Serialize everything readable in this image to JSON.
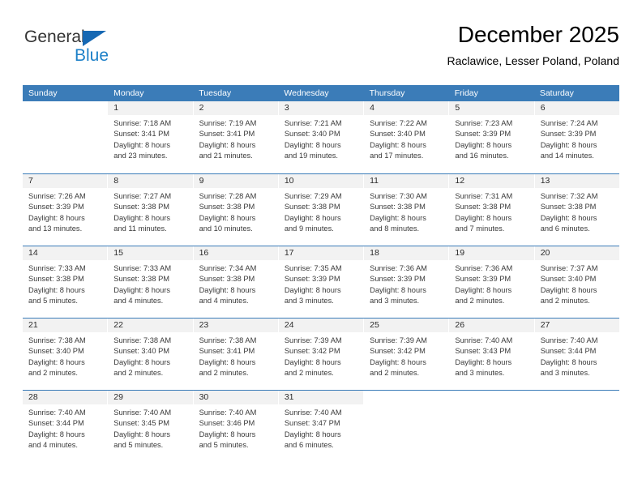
{
  "logo": {
    "name_part1": "General",
    "name_part2": "Blue",
    "triangle_color": "#1668b3",
    "blue_color": "#1d80c8"
  },
  "header": {
    "title": "December 2025",
    "subtitle": "Raclawice, Lesser Poland, Poland"
  },
  "theme": {
    "header_blue": "#3b7cb8",
    "daynum_bg": "#f2f2f2"
  },
  "weekdays": [
    "Sunday",
    "Monday",
    "Tuesday",
    "Wednesday",
    "Thursday",
    "Friday",
    "Saturday"
  ],
  "weeks": [
    [
      {
        "day": "",
        "lines": []
      },
      {
        "day": "1",
        "lines": [
          "Sunrise: 7:18 AM",
          "Sunset: 3:41 PM",
          "Daylight: 8 hours",
          "and 23 minutes."
        ]
      },
      {
        "day": "2",
        "lines": [
          "Sunrise: 7:19 AM",
          "Sunset: 3:41 PM",
          "Daylight: 8 hours",
          "and 21 minutes."
        ]
      },
      {
        "day": "3",
        "lines": [
          "Sunrise: 7:21 AM",
          "Sunset: 3:40 PM",
          "Daylight: 8 hours",
          "and 19 minutes."
        ]
      },
      {
        "day": "4",
        "lines": [
          "Sunrise: 7:22 AM",
          "Sunset: 3:40 PM",
          "Daylight: 8 hours",
          "and 17 minutes."
        ]
      },
      {
        "day": "5",
        "lines": [
          "Sunrise: 7:23 AM",
          "Sunset: 3:39 PM",
          "Daylight: 8 hours",
          "and 16 minutes."
        ]
      },
      {
        "day": "6",
        "lines": [
          "Sunrise: 7:24 AM",
          "Sunset: 3:39 PM",
          "Daylight: 8 hours",
          "and 14 minutes."
        ]
      }
    ],
    [
      {
        "day": "7",
        "lines": [
          "Sunrise: 7:26 AM",
          "Sunset: 3:39 PM",
          "Daylight: 8 hours",
          "and 13 minutes."
        ]
      },
      {
        "day": "8",
        "lines": [
          "Sunrise: 7:27 AM",
          "Sunset: 3:38 PM",
          "Daylight: 8 hours",
          "and 11 minutes."
        ]
      },
      {
        "day": "9",
        "lines": [
          "Sunrise: 7:28 AM",
          "Sunset: 3:38 PM",
          "Daylight: 8 hours",
          "and 10 minutes."
        ]
      },
      {
        "day": "10",
        "lines": [
          "Sunrise: 7:29 AM",
          "Sunset: 3:38 PM",
          "Daylight: 8 hours",
          "and 9 minutes."
        ]
      },
      {
        "day": "11",
        "lines": [
          "Sunrise: 7:30 AM",
          "Sunset: 3:38 PM",
          "Daylight: 8 hours",
          "and 8 minutes."
        ]
      },
      {
        "day": "12",
        "lines": [
          "Sunrise: 7:31 AM",
          "Sunset: 3:38 PM",
          "Daylight: 8 hours",
          "and 7 minutes."
        ]
      },
      {
        "day": "13",
        "lines": [
          "Sunrise: 7:32 AM",
          "Sunset: 3:38 PM",
          "Daylight: 8 hours",
          "and 6 minutes."
        ]
      }
    ],
    [
      {
        "day": "14",
        "lines": [
          "Sunrise: 7:33 AM",
          "Sunset: 3:38 PM",
          "Daylight: 8 hours",
          "and 5 minutes."
        ]
      },
      {
        "day": "15",
        "lines": [
          "Sunrise: 7:33 AM",
          "Sunset: 3:38 PM",
          "Daylight: 8 hours",
          "and 4 minutes."
        ]
      },
      {
        "day": "16",
        "lines": [
          "Sunrise: 7:34 AM",
          "Sunset: 3:38 PM",
          "Daylight: 8 hours",
          "and 4 minutes."
        ]
      },
      {
        "day": "17",
        "lines": [
          "Sunrise: 7:35 AM",
          "Sunset: 3:39 PM",
          "Daylight: 8 hours",
          "and 3 minutes."
        ]
      },
      {
        "day": "18",
        "lines": [
          "Sunrise: 7:36 AM",
          "Sunset: 3:39 PM",
          "Daylight: 8 hours",
          "and 3 minutes."
        ]
      },
      {
        "day": "19",
        "lines": [
          "Sunrise: 7:36 AM",
          "Sunset: 3:39 PM",
          "Daylight: 8 hours",
          "and 2 minutes."
        ]
      },
      {
        "day": "20",
        "lines": [
          "Sunrise: 7:37 AM",
          "Sunset: 3:40 PM",
          "Daylight: 8 hours",
          "and 2 minutes."
        ]
      }
    ],
    [
      {
        "day": "21",
        "lines": [
          "Sunrise: 7:38 AM",
          "Sunset: 3:40 PM",
          "Daylight: 8 hours",
          "and 2 minutes."
        ]
      },
      {
        "day": "22",
        "lines": [
          "Sunrise: 7:38 AM",
          "Sunset: 3:40 PM",
          "Daylight: 8 hours",
          "and 2 minutes."
        ]
      },
      {
        "day": "23",
        "lines": [
          "Sunrise: 7:38 AM",
          "Sunset: 3:41 PM",
          "Daylight: 8 hours",
          "and 2 minutes."
        ]
      },
      {
        "day": "24",
        "lines": [
          "Sunrise: 7:39 AM",
          "Sunset: 3:42 PM",
          "Daylight: 8 hours",
          "and 2 minutes."
        ]
      },
      {
        "day": "25",
        "lines": [
          "Sunrise: 7:39 AM",
          "Sunset: 3:42 PM",
          "Daylight: 8 hours",
          "and 2 minutes."
        ]
      },
      {
        "day": "26",
        "lines": [
          "Sunrise: 7:40 AM",
          "Sunset: 3:43 PM",
          "Daylight: 8 hours",
          "and 3 minutes."
        ]
      },
      {
        "day": "27",
        "lines": [
          "Sunrise: 7:40 AM",
          "Sunset: 3:44 PM",
          "Daylight: 8 hours",
          "and 3 minutes."
        ]
      }
    ],
    [
      {
        "day": "28",
        "lines": [
          "Sunrise: 7:40 AM",
          "Sunset: 3:44 PM",
          "Daylight: 8 hours",
          "and 4 minutes."
        ]
      },
      {
        "day": "29",
        "lines": [
          "Sunrise: 7:40 AM",
          "Sunset: 3:45 PM",
          "Daylight: 8 hours",
          "and 5 minutes."
        ]
      },
      {
        "day": "30",
        "lines": [
          "Sunrise: 7:40 AM",
          "Sunset: 3:46 PM",
          "Daylight: 8 hours",
          "and 5 minutes."
        ]
      },
      {
        "day": "31",
        "lines": [
          "Sunrise: 7:40 AM",
          "Sunset: 3:47 PM",
          "Daylight: 8 hours",
          "and 6 minutes."
        ]
      },
      {
        "day": "",
        "lines": []
      },
      {
        "day": "",
        "lines": []
      },
      {
        "day": "",
        "lines": []
      }
    ]
  ]
}
